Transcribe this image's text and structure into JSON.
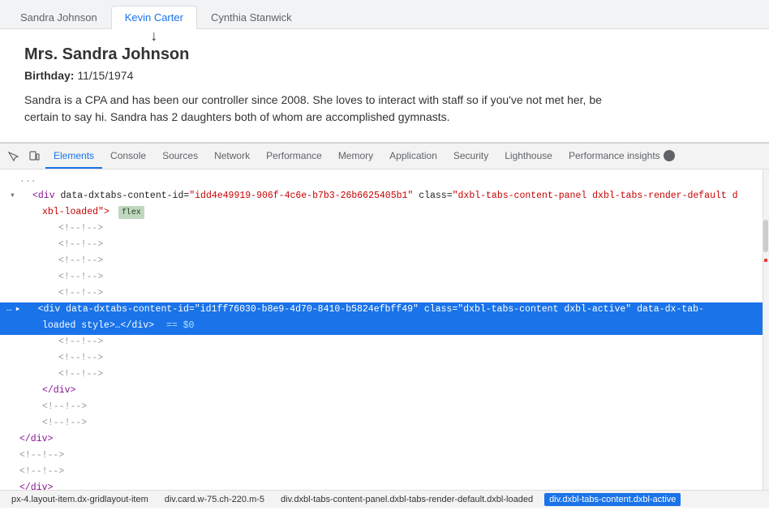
{
  "browser_tabs": [
    {
      "label": "Sandra Johnson",
      "active": false
    },
    {
      "label": "Kevin Carter",
      "active": true
    },
    {
      "label": "Cynthia Stanwick",
      "active": false
    }
  ],
  "person": {
    "name": "Mrs. Sandra Johnson",
    "birthday_label": "Birthday:",
    "birthday_value": "11/15/1974",
    "bio": "Sandra is a CPA and has been our controller since 2008. She loves to interact with staff so if you've not met her, be certain to say hi. Sandra has 2 daughters both of whom are accomplished gymnasts."
  },
  "devtools": {
    "tabs": [
      {
        "label": "Elements",
        "active": true
      },
      {
        "label": "Console",
        "active": false
      },
      {
        "label": "Sources",
        "active": false
      },
      {
        "label": "Network",
        "active": false
      },
      {
        "label": "Performance",
        "active": false
      },
      {
        "label": "Memory",
        "active": false
      },
      {
        "label": "Application",
        "active": false
      },
      {
        "label": "Security",
        "active": false
      },
      {
        "label": "Lighthouse",
        "active": false
      },
      {
        "label": "Performance insights",
        "active": false
      }
    ],
    "code_lines": [
      {
        "indent": 0,
        "arrow": "none",
        "content_parts": [
          {
            "text": "...",
            "class": "c-gray"
          }
        ],
        "highlighted": false,
        "dot": false
      },
      {
        "indent": 4,
        "arrow": "expanded",
        "content_parts": [
          {
            "text": "<div",
            "class": "c-purple"
          },
          {
            "text": " data-dxtabs-content-id=",
            "class": "c-dark"
          },
          {
            "text": "\"idd4e49919-906f-4c6e-b7b3-26b6625405b1\"",
            "class": "c-red"
          },
          {
            "text": " class=",
            "class": "c-dark"
          },
          {
            "text": "\"dxbl-tabs-content-panel dxbl-tabs-render-default d",
            "class": "c-red"
          }
        ],
        "highlighted": false,
        "dot": false,
        "continued": true
      },
      {
        "indent": 4,
        "arrow": "none",
        "content_parts": [
          {
            "text": "xbl-loaded\">",
            "class": "c-red"
          },
          {
            "text": " flex",
            "class": "badge"
          }
        ],
        "highlighted": false,
        "dot": false
      },
      {
        "indent": 8,
        "arrow": "none",
        "content_parts": [
          {
            "text": "<!--!-->",
            "class": "c-gray"
          }
        ],
        "highlighted": false,
        "dot": false
      },
      {
        "indent": 8,
        "arrow": "none",
        "content_parts": [
          {
            "text": "<!--!-->",
            "class": "c-gray"
          }
        ],
        "highlighted": false,
        "dot": false
      },
      {
        "indent": 8,
        "arrow": "none",
        "content_parts": [
          {
            "text": "<!--!-->",
            "class": "c-gray"
          }
        ],
        "highlighted": false,
        "dot": false
      },
      {
        "indent": 8,
        "arrow": "none",
        "content_parts": [
          {
            "text": "<!--!-->",
            "class": "c-gray"
          }
        ],
        "highlighted": false,
        "dot": false
      },
      {
        "indent": 8,
        "arrow": "none",
        "content_parts": [
          {
            "text": "<!--!-->",
            "class": "c-gray"
          }
        ],
        "highlighted": false,
        "dot": false
      },
      {
        "indent": 4,
        "arrow": "collapsed",
        "content_parts": [
          {
            "text": "<div",
            "class": "c-purple"
          },
          {
            "text": " data-dxtabs-content-id=",
            "class": "c-dark"
          },
          {
            "text": "\"id1ff76030-b8e9-4d70-8410-b5824efbff49\"",
            "class": "c-red"
          },
          {
            "text": " class=",
            "class": "c-dark"
          },
          {
            "text": "\"dxbl-tabs-content dxbl-active\"",
            "class": "c-red"
          },
          {
            "text": " data-dx-tab-",
            "class": "c-dark"
          }
        ],
        "highlighted": true,
        "dot": true
      },
      {
        "indent": 4,
        "arrow": "none",
        "content_parts": [
          {
            "text": "loaded style>…</div>",
            "class": "c-dark"
          },
          {
            "text": " == $0",
            "class": "dollar"
          }
        ],
        "highlighted": true,
        "dot": false
      },
      {
        "indent": 8,
        "arrow": "none",
        "content_parts": [
          {
            "text": "<!--!-->",
            "class": "c-gray"
          }
        ],
        "highlighted": false,
        "dot": false
      },
      {
        "indent": 8,
        "arrow": "none",
        "content_parts": [
          {
            "text": "<!--!-->",
            "class": "c-gray"
          }
        ],
        "highlighted": false,
        "dot": false
      },
      {
        "indent": 8,
        "arrow": "none",
        "content_parts": [
          {
            "text": "<!--!-->",
            "class": "c-gray"
          }
        ],
        "highlighted": false,
        "dot": false
      },
      {
        "indent": 4,
        "arrow": "none",
        "content_parts": [
          {
            "text": "</div>",
            "class": "c-purple"
          }
        ],
        "highlighted": false,
        "dot": false
      },
      {
        "indent": 4,
        "arrow": "none",
        "content_parts": [
          {
            "text": "<!--!-->",
            "class": "c-gray"
          }
        ],
        "highlighted": false,
        "dot": false
      },
      {
        "indent": 4,
        "arrow": "none",
        "content_parts": [
          {
            "text": "<!--!-->",
            "class": "c-gray"
          }
        ],
        "highlighted": false,
        "dot": false
      },
      {
        "indent": 0,
        "arrow": "none",
        "content_parts": [
          {
            "text": "</div>",
            "class": "c-purple"
          }
        ],
        "highlighted": false,
        "dot": false
      },
      {
        "indent": 0,
        "arrow": "none",
        "content_parts": [
          {
            "text": "<!--!-->",
            "class": "c-gray"
          }
        ],
        "highlighted": false,
        "dot": false
      },
      {
        "indent": 0,
        "arrow": "none",
        "content_parts": [
          {
            "text": "<!--!-->",
            "class": "c-gray"
          }
        ],
        "highlighted": false,
        "dot": false
      },
      {
        "indent": 0,
        "arrow": "none",
        "content_parts": [
          {
            "text": "</div>",
            "class": "c-purple"
          }
        ],
        "highlighted": false,
        "dot": false
      }
    ],
    "status_bar": [
      {
        "label": "px-4.layout-item.dx-gridlayout-item",
        "active": false
      },
      {
        "label": "div.card.w-75.ch-220.m-5",
        "active": false
      },
      {
        "label": "div.dxbl-tabs-content-panel.dxbl-tabs-render-default.dxbl-loaded",
        "active": false
      },
      {
        "label": "div.dxbl-tabs-content.dxbl-active",
        "active": true
      }
    ]
  }
}
